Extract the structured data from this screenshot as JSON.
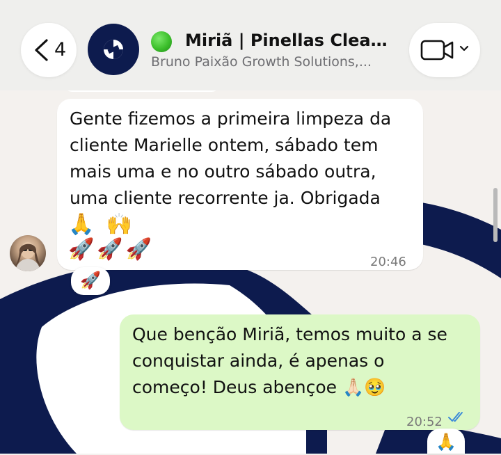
{
  "header": {
    "back_count": "4",
    "chat_title": "Miriã | Pinellas Cleanin...",
    "chat_subtitle": "Bruno Paixão Growth Solutions,...",
    "status_color": "#3cbf2b",
    "video_icon": "video-camera-icon"
  },
  "messages": [
    {
      "direction": "incoming",
      "text_lines": [
        "Gente fizemos a primeira limpeza da",
        "cliente Marielle ontem, sábado tem",
        "mais uma e no outro sábado outra,",
        "uma cliente recorrente ja. Obrigada"
      ],
      "emoji_line1": "🙏 🙌",
      "emoji_line2": "🚀🚀🚀",
      "time": "20:46",
      "reaction": "🚀"
    },
    {
      "direction": "outgoing",
      "text_lines": [
        "Que benção Miriã, temos muito a se",
        "conquistar ainda, é apenas o",
        "começo! Deus abençoe 🙏🏻🥹"
      ],
      "time": "20:52",
      "read_status_color": "#3d8bd9",
      "reaction": "🙏"
    }
  ],
  "colors": {
    "incoming_bubble": "#ffffff",
    "outgoing_bubble": "#dcf8c6",
    "wallpaper_accent": "#0d1b4e"
  }
}
